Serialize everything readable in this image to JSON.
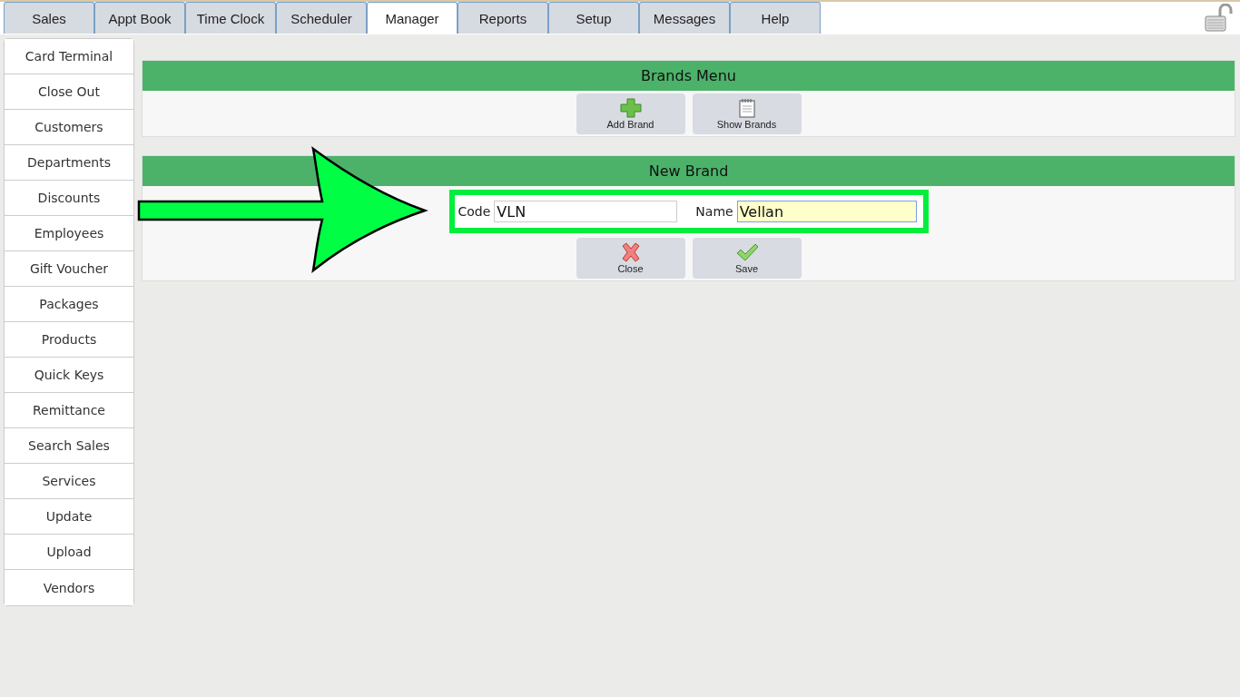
{
  "tabs": [
    {
      "label": "Sales",
      "selected": false
    },
    {
      "label": "Appt Book",
      "selected": false
    },
    {
      "label": "Time Clock",
      "selected": false
    },
    {
      "label": "Scheduler",
      "selected": false
    },
    {
      "label": "Manager",
      "selected": true
    },
    {
      "label": "Reports",
      "selected": false
    },
    {
      "label": "Setup",
      "selected": false
    },
    {
      "label": "Messages",
      "selected": false
    },
    {
      "label": "Help",
      "selected": false
    }
  ],
  "sidebar": {
    "items": [
      "Card Terminal",
      "Close Out",
      "Customers",
      "Departments",
      "Discounts",
      "Employees",
      "Gift Voucher",
      "Packages",
      "Products",
      "Quick Keys",
      "Remittance",
      "Search Sales",
      "Services",
      "Update",
      "Upload",
      "Vendors"
    ]
  },
  "brands_menu": {
    "title": "Brands Menu",
    "buttons": [
      {
        "label": "Add Brand",
        "kind": "add"
      },
      {
        "label": "Show Brands",
        "kind": "list"
      }
    ]
  },
  "new_brand": {
    "title": "New Brand",
    "fields": [
      {
        "label": "Code",
        "value": "VLN",
        "focused": false
      },
      {
        "label": "Name",
        "value": "Vellan",
        "focused": true
      }
    ],
    "buttons": [
      {
        "label": "Close",
        "kind": "close"
      },
      {
        "label": "Save",
        "kind": "save"
      }
    ]
  }
}
